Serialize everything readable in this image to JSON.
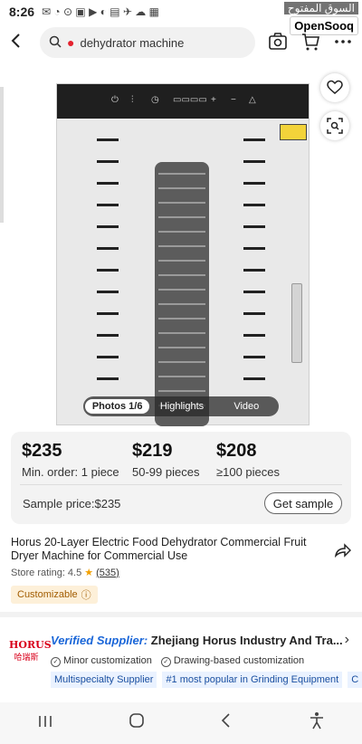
{
  "status_bar": {
    "time": "8:26"
  },
  "watermark": {
    "arabic": "السوق المفتوح",
    "brand": "OpenSooq"
  },
  "search": {
    "query": "dehydrator machine"
  },
  "media": {
    "tabs": [
      "Photos 1/6",
      "Highlights",
      "Video"
    ]
  },
  "pricing": {
    "tiers": [
      {
        "price": "$235",
        "qty": "Min. order: 1 piece"
      },
      {
        "price": "$219",
        "qty": "50-99 pieces"
      },
      {
        "price": "$208",
        "qty": "≥100 pieces"
      }
    ],
    "sample_price": "Sample price:$235",
    "get_sample": "Get sample"
  },
  "product": {
    "title": "Horus 20-Layer Electric Food Dehydrator Commercial Fruit Dryer Machine for Commercial Use",
    "store_rating_label": "Store rating:",
    "rating": "4.5",
    "rating_count": "(535)",
    "customizable": "Customizable"
  },
  "supplier": {
    "logo_text": "HORUS",
    "logo_sub": "哈瑞斯",
    "verified_label": "Verified Supplier:",
    "name": "Zhejiang Horus Industry And Tra...",
    "capabilities": [
      "Minor customization",
      "Drawing-based customization"
    ],
    "tags": [
      "Multispecialty Supplier",
      "#1 most popular in Grinding Equipment",
      "C"
    ]
  },
  "colors": {
    "accent_blue": "#1a66d8",
    "price_bg": "#f3f3f3",
    "custom_bg": "#fdf0d9"
  }
}
